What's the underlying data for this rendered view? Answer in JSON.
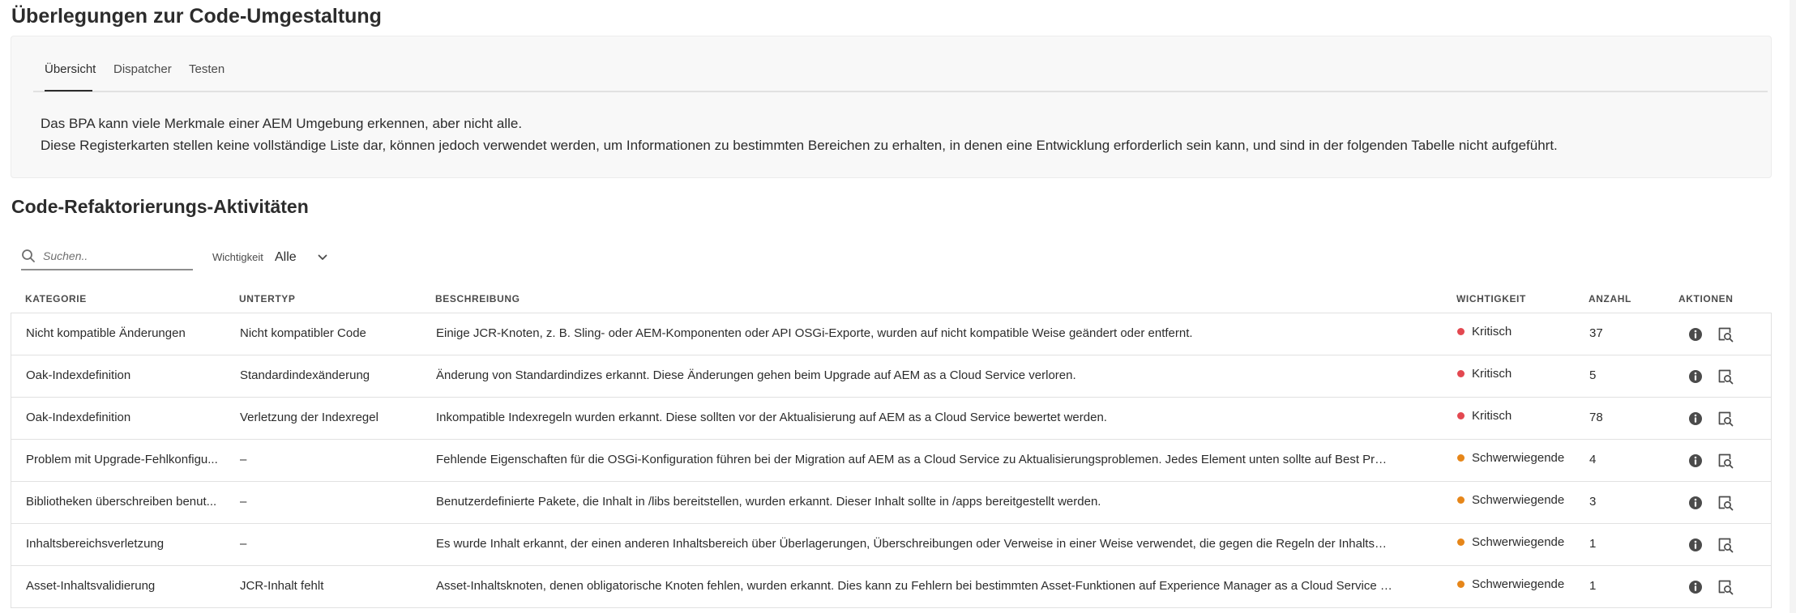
{
  "page_title": "Überlegungen zur Code-Umgestaltung",
  "tabs": [
    {
      "label": "Übersicht",
      "selected": true
    },
    {
      "label": "Dispatcher",
      "selected": false
    },
    {
      "label": "Testen",
      "selected": false
    }
  ],
  "info": {
    "line1": "Das BPA kann viele Merkmale einer AEM Umgebung erkennen, aber nicht alle.",
    "line2": "Diese Registerkarten stellen keine vollständige Liste dar, können jedoch verwendet werden, um Informationen zu bestimmten Bereichen zu erhalten, in denen eine Entwicklung erforderlich sein kann, und sind in der folgenden Tabelle nicht aufgeführt."
  },
  "section_title": "Code-Refaktorierungs-Aktivitäten",
  "search": {
    "placeholder": "Suchen..",
    "value": "",
    "icon": "search-icon"
  },
  "filter": {
    "label": "Wichtigkeit",
    "value": "Alle",
    "icon": "chevron-down-icon"
  },
  "table": {
    "headers": {
      "category": "KATEGORIE",
      "subtype": "UNTERTYP",
      "description": "BESCHREIBUNG",
      "severity": "WICHTIGKEIT",
      "count": "ANZAHL",
      "actions": "AKTIONEN"
    },
    "action_icons": [
      "info-icon",
      "preview-icon"
    ],
    "rows": [
      {
        "category": "Nicht kompatible Änderungen",
        "subtype": "Nicht kompatibler Code",
        "description": "Einige JCR-Knoten, z. B. Sling- oder AEM-Komponenten oder API OSGi-Exporte, wurden auf nicht kompatible Weise geändert oder entfernt.",
        "severity": "Kritisch",
        "severity_color": "#e34850",
        "count": "37"
      },
      {
        "category": "Oak-Indexdefinition",
        "subtype": "Standardindexänderung",
        "description": "Änderung von Standardindizes erkannt. Diese Änderungen gehen beim Upgrade auf AEM as a Cloud Service verloren.",
        "severity": "Kritisch",
        "severity_color": "#e34850",
        "count": "5"
      },
      {
        "category": "Oak-Indexdefinition",
        "subtype": "Verletzung der Indexregel",
        "description": "Inkompatible Indexregeln wurden erkannt. Diese sollten vor der Aktualisierung auf AEM as a Cloud Service bewertet werden.",
        "severity": "Kritisch",
        "severity_color": "#e34850",
        "count": "78"
      },
      {
        "category": "Problem mit Upgrade-Fehlkonfigu...",
        "subtype": "–",
        "description": "Fehlende Eigenschaften für die OSGi-Konfiguration führen bei der Migration auf AEM as a Cloud Service zu Aktualisierungsproblemen. Jedes Element unten sollte auf Best Practices hin b...",
        "severity": "Schwerwiegende",
        "severity_color": "#e68619",
        "count": "4"
      },
      {
        "category": "Bibliotheken überschreiben benut...",
        "subtype": "–",
        "description": "Benutzerdefinierte Pakete, die Inhalt in /libs bereitstellen, wurden erkannt. Dieser Inhalt sollte in /apps bereitgestellt werden.",
        "severity": "Schwerwiegende",
        "severity_color": "#e68619",
        "count": "3"
      },
      {
        "category": "Inhaltsbereichsverletzung",
        "subtype": "–",
        "description": "Es wurde Inhalt erkannt, der einen anderen Inhaltsbereich über Überlagerungen, Überschreibungen oder Verweise in einer Weise verwendet, die gegen die Regeln der Inhaltsklassifizieru...",
        "severity": "Schwerwiegende",
        "severity_color": "#e68619",
        "count": "1"
      },
      {
        "category": "Asset-Inhaltsvalidierung",
        "subtype": "JCR-Inhalt fehlt",
        "description": "Asset-Inhaltsknoten, denen obligatorische Knoten fehlen, wurden erkannt. Dies kann zu Fehlern bei bestimmten Asset-Funktionen auf Experience Manager as a Cloud Service führen.",
        "severity": "Schwerwiegende",
        "severity_color": "#e68619",
        "count": "1"
      }
    ]
  }
}
